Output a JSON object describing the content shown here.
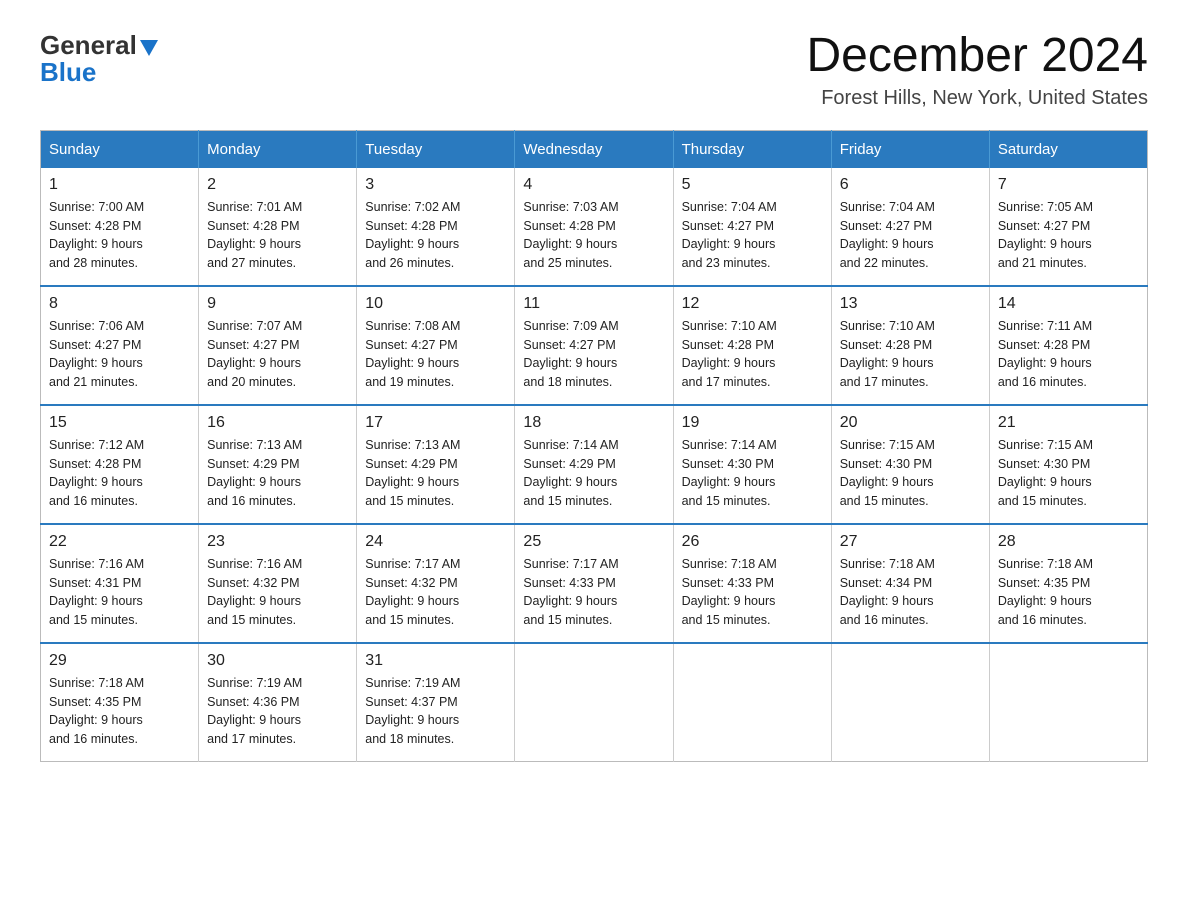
{
  "header": {
    "logo_general": "General",
    "logo_blue": "Blue",
    "month_title": "December 2024",
    "location": "Forest Hills, New York, United States"
  },
  "days_of_week": [
    "Sunday",
    "Monday",
    "Tuesday",
    "Wednesday",
    "Thursday",
    "Friday",
    "Saturday"
  ],
  "weeks": [
    [
      {
        "num": "1",
        "sunrise": "7:00 AM",
        "sunset": "4:28 PM",
        "daylight": "9 hours and 28 minutes."
      },
      {
        "num": "2",
        "sunrise": "7:01 AM",
        "sunset": "4:28 PM",
        "daylight": "9 hours and 27 minutes."
      },
      {
        "num": "3",
        "sunrise": "7:02 AM",
        "sunset": "4:28 PM",
        "daylight": "9 hours and 26 minutes."
      },
      {
        "num": "4",
        "sunrise": "7:03 AM",
        "sunset": "4:28 PM",
        "daylight": "9 hours and 25 minutes."
      },
      {
        "num": "5",
        "sunrise": "7:04 AM",
        "sunset": "4:27 PM",
        "daylight": "9 hours and 23 minutes."
      },
      {
        "num": "6",
        "sunrise": "7:04 AM",
        "sunset": "4:27 PM",
        "daylight": "9 hours and 22 minutes."
      },
      {
        "num": "7",
        "sunrise": "7:05 AM",
        "sunset": "4:27 PM",
        "daylight": "9 hours and 21 minutes."
      }
    ],
    [
      {
        "num": "8",
        "sunrise": "7:06 AM",
        "sunset": "4:27 PM",
        "daylight": "9 hours and 21 minutes."
      },
      {
        "num": "9",
        "sunrise": "7:07 AM",
        "sunset": "4:27 PM",
        "daylight": "9 hours and 20 minutes."
      },
      {
        "num": "10",
        "sunrise": "7:08 AM",
        "sunset": "4:27 PM",
        "daylight": "9 hours and 19 minutes."
      },
      {
        "num": "11",
        "sunrise": "7:09 AM",
        "sunset": "4:27 PM",
        "daylight": "9 hours and 18 minutes."
      },
      {
        "num": "12",
        "sunrise": "7:10 AM",
        "sunset": "4:28 PM",
        "daylight": "9 hours and 17 minutes."
      },
      {
        "num": "13",
        "sunrise": "7:10 AM",
        "sunset": "4:28 PM",
        "daylight": "9 hours and 17 minutes."
      },
      {
        "num": "14",
        "sunrise": "7:11 AM",
        "sunset": "4:28 PM",
        "daylight": "9 hours and 16 minutes."
      }
    ],
    [
      {
        "num": "15",
        "sunrise": "7:12 AM",
        "sunset": "4:28 PM",
        "daylight": "9 hours and 16 minutes."
      },
      {
        "num": "16",
        "sunrise": "7:13 AM",
        "sunset": "4:29 PM",
        "daylight": "9 hours and 16 minutes."
      },
      {
        "num": "17",
        "sunrise": "7:13 AM",
        "sunset": "4:29 PM",
        "daylight": "9 hours and 15 minutes."
      },
      {
        "num": "18",
        "sunrise": "7:14 AM",
        "sunset": "4:29 PM",
        "daylight": "9 hours and 15 minutes."
      },
      {
        "num": "19",
        "sunrise": "7:14 AM",
        "sunset": "4:30 PM",
        "daylight": "9 hours and 15 minutes."
      },
      {
        "num": "20",
        "sunrise": "7:15 AM",
        "sunset": "4:30 PM",
        "daylight": "9 hours and 15 minutes."
      },
      {
        "num": "21",
        "sunrise": "7:15 AM",
        "sunset": "4:30 PM",
        "daylight": "9 hours and 15 minutes."
      }
    ],
    [
      {
        "num": "22",
        "sunrise": "7:16 AM",
        "sunset": "4:31 PM",
        "daylight": "9 hours and 15 minutes."
      },
      {
        "num": "23",
        "sunrise": "7:16 AM",
        "sunset": "4:32 PM",
        "daylight": "9 hours and 15 minutes."
      },
      {
        "num": "24",
        "sunrise": "7:17 AM",
        "sunset": "4:32 PM",
        "daylight": "9 hours and 15 minutes."
      },
      {
        "num": "25",
        "sunrise": "7:17 AM",
        "sunset": "4:33 PM",
        "daylight": "9 hours and 15 minutes."
      },
      {
        "num": "26",
        "sunrise": "7:18 AM",
        "sunset": "4:33 PM",
        "daylight": "9 hours and 15 minutes."
      },
      {
        "num": "27",
        "sunrise": "7:18 AM",
        "sunset": "4:34 PM",
        "daylight": "9 hours and 16 minutes."
      },
      {
        "num": "28",
        "sunrise": "7:18 AM",
        "sunset": "4:35 PM",
        "daylight": "9 hours and 16 minutes."
      }
    ],
    [
      {
        "num": "29",
        "sunrise": "7:18 AM",
        "sunset": "4:35 PM",
        "daylight": "9 hours and 16 minutes."
      },
      {
        "num": "30",
        "sunrise": "7:19 AM",
        "sunset": "4:36 PM",
        "daylight": "9 hours and 17 minutes."
      },
      {
        "num": "31",
        "sunrise": "7:19 AM",
        "sunset": "4:37 PM",
        "daylight": "9 hours and 18 minutes."
      },
      null,
      null,
      null,
      null
    ]
  ]
}
